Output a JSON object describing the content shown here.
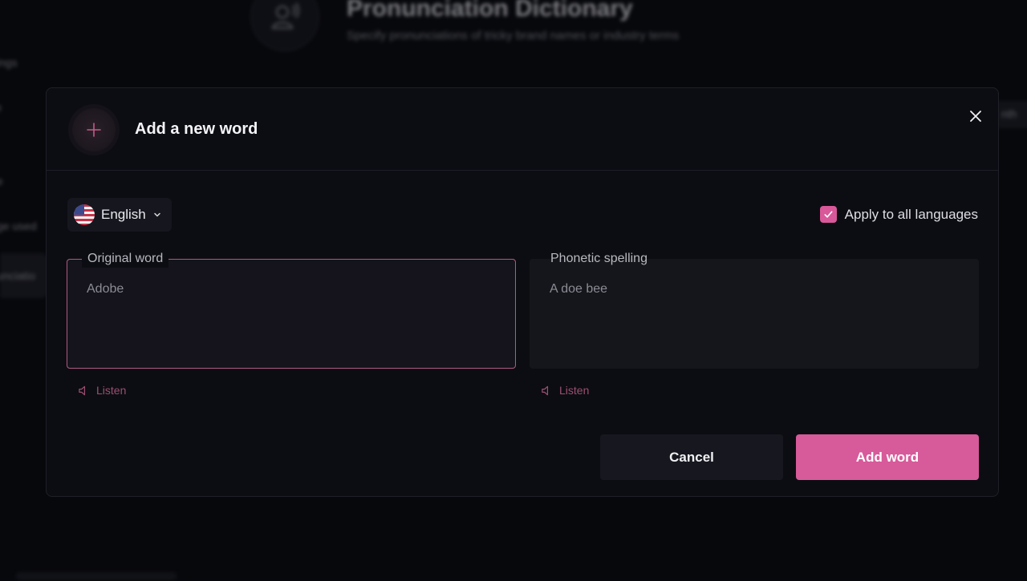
{
  "background": {
    "title": "Pronunciation Dictionary",
    "subtitle": "Specify pronunciations of tricky brand names or industry terms",
    "sidebar_fragments": [
      "ttings",
      "ile",
      "s",
      "ge",
      "age used",
      "nunciatio"
    ],
    "right_button_fragment": "nth"
  },
  "modal": {
    "title": "Add a new word",
    "language": {
      "selected": "English",
      "flag_icon": "us-flag-icon"
    },
    "apply_all": {
      "label": "Apply to all languages",
      "checked": true
    },
    "original_word": {
      "label": "Original word",
      "placeholder": "Adobe",
      "value": ""
    },
    "phonetic_spelling": {
      "label": "Phonetic spelling",
      "placeholder": "A doe bee",
      "value": ""
    },
    "listen_label_original": "Listen",
    "listen_label_phonetic": "Listen",
    "buttons": {
      "cancel": "Cancel",
      "add": "Add word"
    }
  },
  "colors": {
    "accent": "#d75a9a",
    "modal_bg": "#0c0d12",
    "field_bg": "#15161c",
    "page_bg": "#07080c"
  }
}
